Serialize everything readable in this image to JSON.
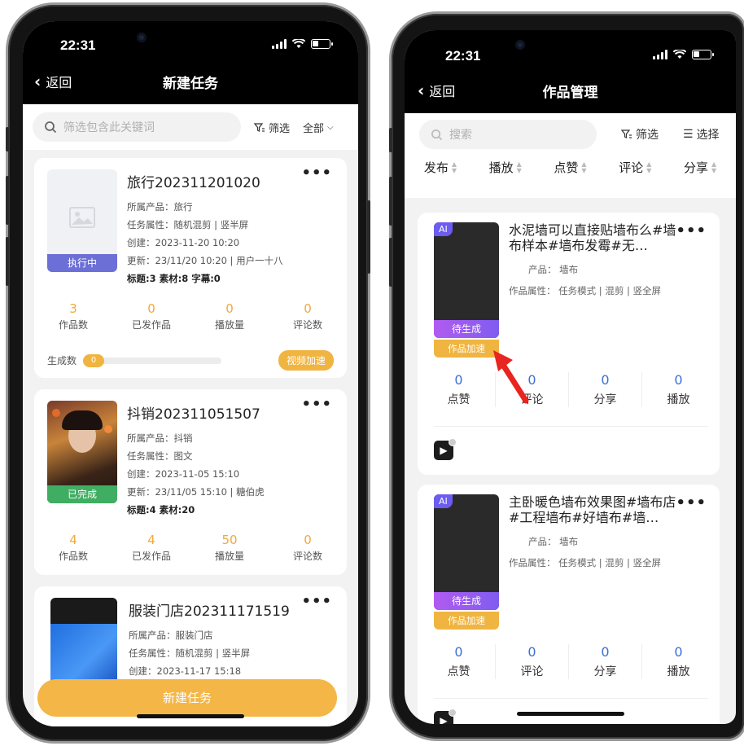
{
  "left": {
    "status": {
      "time": "22:31"
    },
    "nav": {
      "back": "返回",
      "title": "新建任务"
    },
    "search": {
      "placeholder": "筛选包含此关键词",
      "filter": "筛选",
      "all": "全部"
    },
    "tasks": [
      {
        "title": "旅行202311201020",
        "product": "所属产品：旅行",
        "attr": "任务属性：随机混剪 | 竖半屏",
        "created": "创建：2023-11-20 10:20",
        "updated": "更新：23/11/20 10:20 | 用户一十八",
        "counts": "标题:3   素材:8   字幕:0",
        "status": "执行中",
        "stats": [
          {
            "value": "3",
            "label": "作品数"
          },
          {
            "value": "0",
            "label": "已发作品"
          },
          {
            "value": "0",
            "label": "播放量"
          },
          {
            "value": "0",
            "label": "评论数"
          }
        ],
        "progress_label": "生成数",
        "progress_value": "0",
        "accel": "视频加速"
      },
      {
        "title": "抖销202311051507",
        "product": "所属产品：抖销",
        "attr": "任务属性：图文",
        "created": "创建：2023-11-05 15:10",
        "updated": "更新：23/11/05 15:10 | 糖伯虎",
        "counts": "标题:4   素材:20",
        "status": "已完成",
        "stats": [
          {
            "value": "4",
            "label": "作品数"
          },
          {
            "value": "4",
            "label": "已发作品"
          },
          {
            "value": "50",
            "label": "播放量"
          },
          {
            "value": "0",
            "label": "评论数"
          }
        ]
      },
      {
        "title": "服装门店202311171519",
        "product": "所属产品：服装门店",
        "attr": "任务属性：随机混剪 | 竖半屏",
        "created": "创建：2023-11-17 15:18"
      }
    ],
    "create_button": "新建任务"
  },
  "right": {
    "status": {
      "time": "22:31"
    },
    "nav": {
      "back": "返回",
      "title": "作品管理"
    },
    "search": {
      "placeholder": "搜索",
      "filter": "筛选",
      "select": "选择"
    },
    "sort": [
      "发布",
      "播放",
      "点赞",
      "评论",
      "分享"
    ],
    "works": [
      {
        "ai": "AI",
        "title": "水泥墙可以直接贴墙布么#墙布样本#墙布发霉#无…",
        "product": "产品：  墙布",
        "attr": "作品属性：  任务模式 | 混剪 | 竖全屏",
        "gen": "待生成",
        "accel": "作品加速",
        "stats": [
          {
            "value": "0",
            "label": "点赞"
          },
          {
            "value": "0",
            "label": "评论"
          },
          {
            "value": "0",
            "label": "分享"
          },
          {
            "value": "0",
            "label": "播放"
          }
        ]
      },
      {
        "ai": "AI",
        "title": "主卧暖色墙布效果图#墙布店#工程墙布#好墙布#墙…",
        "product": "产品：  墙布",
        "attr": "作品属性：  任务模式 | 混剪 | 竖全屏",
        "gen": "待生成",
        "accel": "作品加速",
        "stats": [
          {
            "value": "0",
            "label": "点赞"
          },
          {
            "value": "0",
            "label": "评论"
          },
          {
            "value": "0",
            "label": "分享"
          },
          {
            "value": "0",
            "label": "播放"
          }
        ]
      }
    ]
  },
  "colors": {
    "accent_orange": "#f0b441",
    "running_badge": "#6c6fd6",
    "done_badge": "#3fae62",
    "value_blue": "#3b6fd8",
    "arrow_red": "#e8251f"
  },
  "icons": [
    "search-icon",
    "filter-icon",
    "chevron-down-icon",
    "back-chevron-icon",
    "more-icon",
    "list-icon",
    "image-placeholder-icon",
    "app-icon"
  ]
}
